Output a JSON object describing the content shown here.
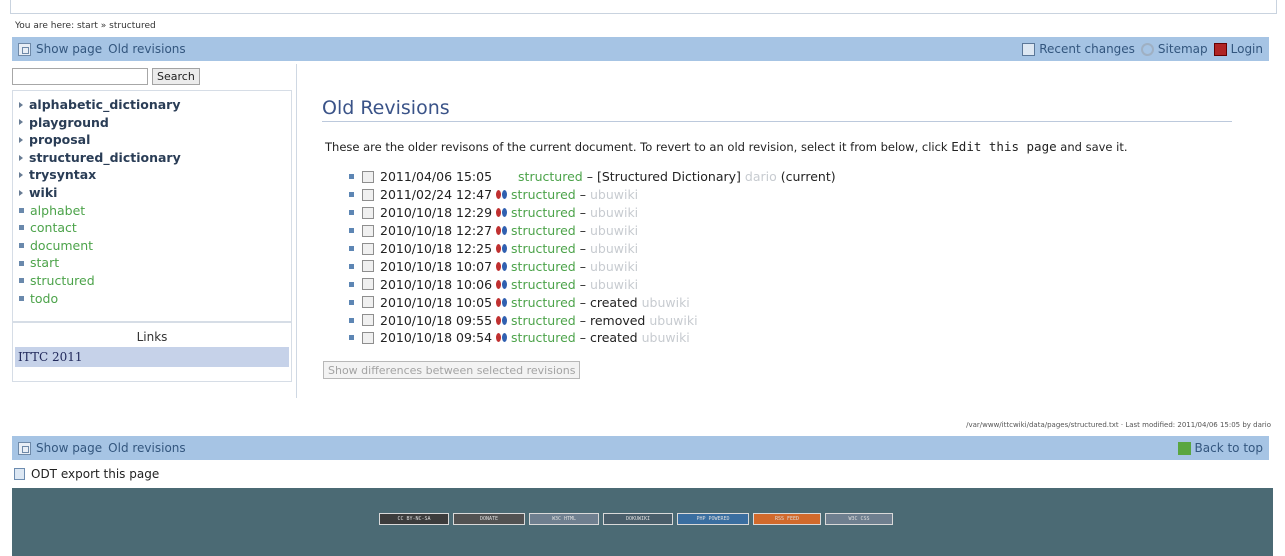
{
  "breadcrumb": "You are here: start » structured",
  "top_bar": {
    "show_page": "Show page",
    "old_revisions": "Old revisions",
    "recent_changes": "Recent changes",
    "sitemap": "Sitemap",
    "login": "Login"
  },
  "search": {
    "button": "Search",
    "value": ""
  },
  "nav": {
    "items": [
      {
        "label": "alphabetic_dictionary",
        "type": "namespace"
      },
      {
        "label": "playground",
        "type": "namespace"
      },
      {
        "label": "proposal",
        "type": "namespace"
      },
      {
        "label": "structured_dictionary",
        "type": "namespace"
      },
      {
        "label": "trysyntax",
        "type": "namespace"
      },
      {
        "label": "wiki",
        "type": "namespace"
      },
      {
        "label": "alphabet",
        "type": "page"
      },
      {
        "label": "contact",
        "type": "page"
      },
      {
        "label": "document",
        "type": "page"
      },
      {
        "label": "start",
        "type": "page"
      },
      {
        "label": "structured",
        "type": "page"
      },
      {
        "label": "todo",
        "type": "page"
      }
    ]
  },
  "links": {
    "title": "Links",
    "item": "ITTC 2011"
  },
  "main": {
    "title": "Old Revisions",
    "intro_before": "These are the older revisons of the current document. To revert to an old revision, select it from below, click",
    "intro_code": "Edit this page",
    "intro_after": "and save it.",
    "revisions": [
      {
        "date": "2011/04/06 15:05",
        "page": "structured",
        "summary": "[Structured Dictionary]",
        "user": "dario",
        "current": "(current)"
      },
      {
        "date": "2011/02/24 12:47",
        "page": "structured",
        "summary": "",
        "user": "ubuwiki"
      },
      {
        "date": "2010/10/18 12:29",
        "page": "structured",
        "summary": "",
        "user": "ubuwiki"
      },
      {
        "date": "2010/10/18 12:27",
        "page": "structured",
        "summary": "",
        "user": "ubuwiki"
      },
      {
        "date": "2010/10/18 12:25",
        "page": "structured",
        "summary": "",
        "user": "ubuwiki"
      },
      {
        "date": "2010/10/18 10:07",
        "page": "structured",
        "summary": "",
        "user": "ubuwiki"
      },
      {
        "date": "2010/10/18 10:06",
        "page": "structured",
        "summary": "",
        "user": "ubuwiki"
      },
      {
        "date": "2010/10/18 10:05",
        "page": "structured",
        "summary": "created",
        "user": "ubuwiki"
      },
      {
        "date": "2010/10/18 09:55",
        "page": "structured",
        "summary": "removed",
        "user": "ubuwiki"
      },
      {
        "date": "2010/10/18 09:54",
        "page": "structured",
        "summary": "created",
        "user": "ubuwiki"
      }
    ],
    "dash": "–",
    "show_diff_button": "Show differences between selected revisions"
  },
  "page_meta": "/var/www/ittcwiki/data/pages/structured.txt · Last modified: 2011/04/06 15:05 by dario",
  "bottom_bar": {
    "show_page": "Show page",
    "old_revisions": "Old revisions",
    "back_to_top": "Back to top"
  },
  "odt_export": "ODT export this page",
  "footer_badges": [
    "CC BY-NC-SA",
    "DONATE",
    "W3C HTML",
    "DOKUWIKI",
    "PHP POWERED",
    "RSS FEED",
    "W3C CSS"
  ]
}
